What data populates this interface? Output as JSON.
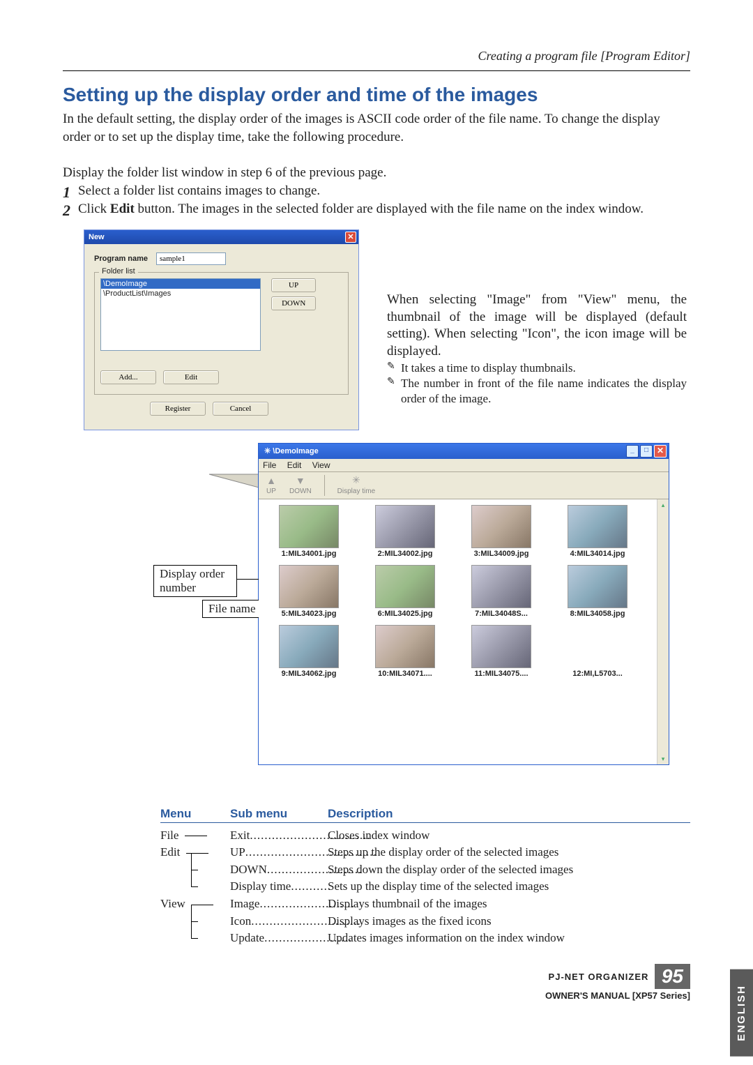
{
  "header": {
    "breadcrumb": "Creating a program file [Program Editor]"
  },
  "title": "Setting up the display order and time of the images",
  "intro": "In the default setting, the display order of the images is ASCII code order of the file name. To change the display order or  to set up the display time, take the following procedure.",
  "stepsLead": "Display the folder list window in step 6 of the previous page.",
  "step1": {
    "n": "1",
    "text": "Select a folder list contains images to change."
  },
  "step2": {
    "n": "2",
    "t1": "Click ",
    "bold": "Edit",
    "t2": " button. The images in the selected folder are displayed with the file name on the index window."
  },
  "sidenote": {
    "p1": "When selecting \"Image\" from \"View\" menu, the thumbnail of the image will be displayed (default setting). When selecting \"Icon\", the icon image will be displayed.",
    "n1": "It takes a time to display thumbnails.",
    "n2": "The number in front of the file name indicates the display order of the image."
  },
  "dlg1": {
    "title": "New",
    "programNameLabel": "Program name",
    "programNameValue": "sample1",
    "folderListLegend": "Folder list",
    "item1": "\\DemoImage",
    "item2": "\\ProductList\\Images",
    "upBtn": "UP",
    "downBtn": "DOWN",
    "addBtn": "Add...",
    "editBtn": "Edit",
    "registerBtn": "Register",
    "cancelBtn": "Cancel"
  },
  "dlg2": {
    "title": "\\DemoImage",
    "menu": {
      "file": "File",
      "edit": "Edit",
      "view": "View"
    },
    "tb": {
      "up": "UP",
      "down": "DOWN",
      "dt": "Display time"
    },
    "thumbs": [
      "1:MIL34001.jpg",
      "2:MIL34002.jpg",
      "3:MIL34009.jpg",
      "4:MIL34014.jpg",
      "5:MIL34023.jpg",
      "6:MIL34025.jpg",
      "7:MIL34048S...",
      "8:MIL34058.jpg",
      "9:MIL34062.jpg",
      "10:MIL34071....",
      "11:MIL34075....",
      "12:MI,L5703..."
    ]
  },
  "callouts": {
    "order": "Display order number",
    "file": "File name"
  },
  "menuTable": {
    "head": {
      "c1": "Menu",
      "c2": "Sub menu",
      "c3": "Description"
    },
    "file": {
      "label": "File",
      "sub": "Exit",
      "desc": "Closes index window"
    },
    "edit": {
      "label": "Edit",
      "rows": [
        {
          "sub": "UP",
          "desc": "Steps up the display order of the selected images"
        },
        {
          "sub": "DOWN",
          "desc": "Steps down the display order of the selected images"
        },
        {
          "sub": "Display time",
          "desc": "Sets up the display time of the selected images"
        }
      ]
    },
    "view": {
      "label": "View",
      "rows": [
        {
          "sub": "Image",
          "desc": "Displays thumbnail of the images"
        },
        {
          "sub": "Icon",
          "desc": "Displays images as the fixed icons"
        },
        {
          "sub": "Update",
          "desc": "Updates images information on the index window"
        }
      ]
    }
  },
  "sideTab": "ENGLISH",
  "footer": {
    "line1": "PJ-NET ORGANIZER",
    "page": "95",
    "line2": "OWNER'S MANUAL [XP57 Series]"
  }
}
